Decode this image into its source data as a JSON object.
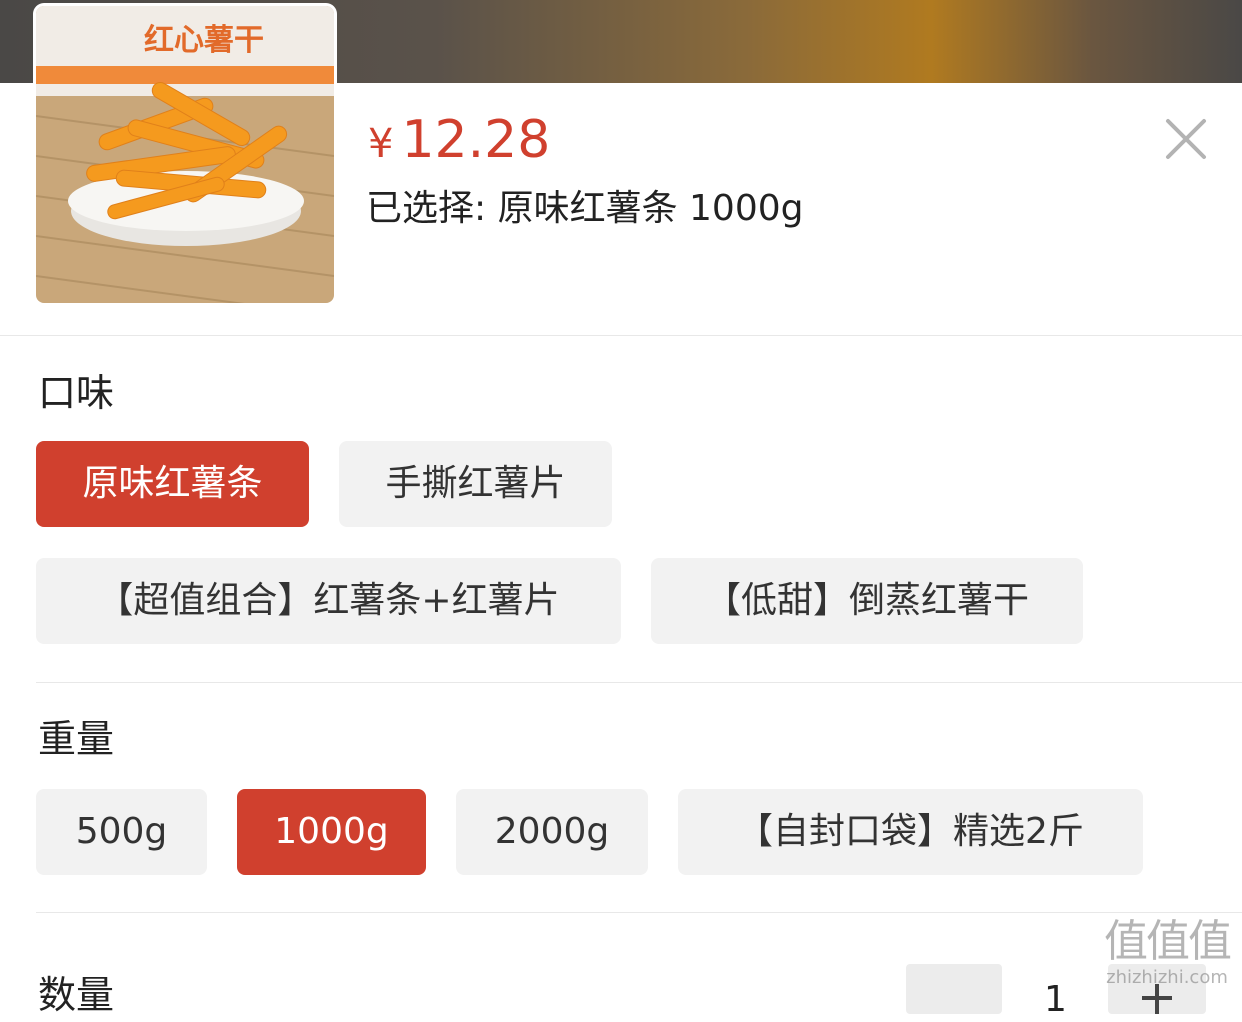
{
  "product": {
    "price_symbol": "¥",
    "price": "12.28",
    "selected_text": "已选择: 原味红薯条 1000g",
    "thumbnail_label": "红心薯干",
    "icon_close": "close-icon"
  },
  "flavor": {
    "title": "口味",
    "options": [
      "原味红薯条",
      "手撕红薯片",
      "【超值组合】红薯条+红薯片",
      "【低甜】倒蒸红薯干"
    ],
    "selected_index": 0
  },
  "weight": {
    "title": "重量",
    "options": [
      "500g",
      "1000g",
      "2000g",
      "【自封口袋】精选2斤"
    ],
    "selected_index": 1
  },
  "quantity": {
    "title": "数量",
    "value": "1",
    "minus_label": "−",
    "plus_label": "+"
  },
  "watermark": {
    "big": "值值值",
    "small": "zhizhizhi.com"
  },
  "colors": {
    "accent": "#d0402e",
    "chip_bg": "#f2f2f2"
  }
}
